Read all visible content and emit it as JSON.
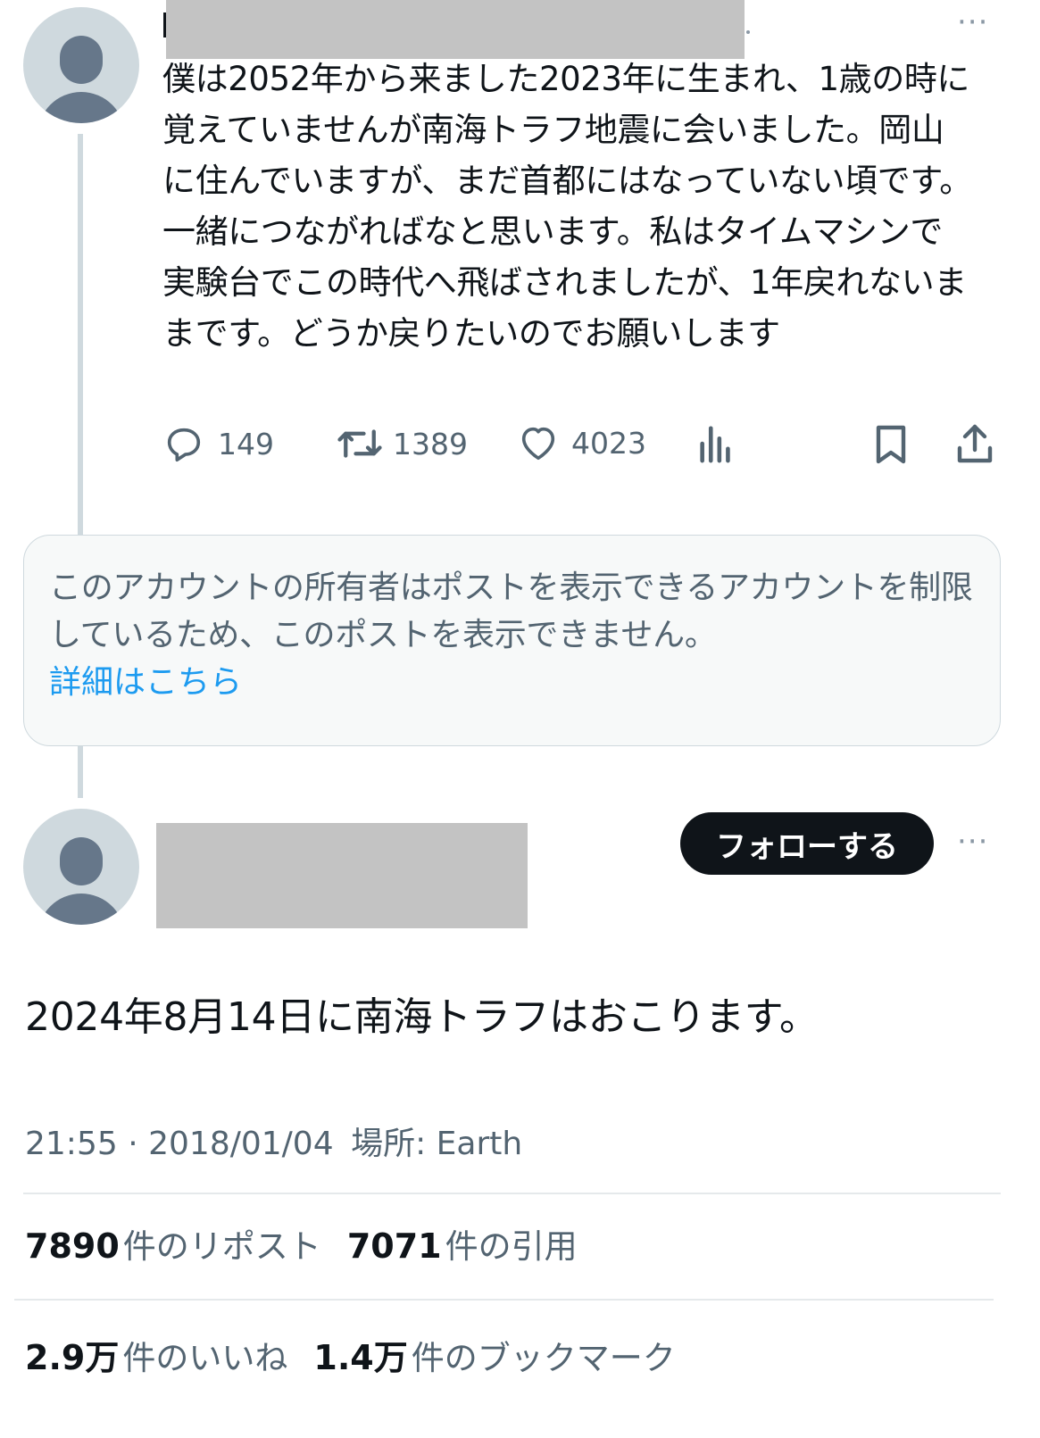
{
  "reply_tweet": {
    "text": "僕は2052年から来ました2023年に生まれ、1歳の時に覚えていませんが南海トラフ地震に会いました。岡山に住んでいますが、まだ首都にはなっていない頃です。一緒につながればなと思います。私はタイムマシンで実験台でこの時代へ飛ばされましたが、1年戻れないままです。どうか戻りたいのでお願いします",
    "more_icon": "···",
    "actions": {
      "replies": "149",
      "reposts": "1389",
      "likes": "4023"
    }
  },
  "restricted_notice": {
    "text": "このアカウントの所有者はポストを表示できるアカウントを制限しているため、このポストを表示できません。",
    "link": "詳細はこちら"
  },
  "main_tweet": {
    "follow_button": "フォローする",
    "more_icon": "···",
    "text": "2024年8月14日に南海トラフはおこります。",
    "time": "21:55",
    "separator": "·",
    "date": "2018/01/04",
    "location": "場所: Earth",
    "stats": {
      "reposts_count": "7890",
      "reposts_label": "件のリポスト",
      "quotes_count": "7071",
      "quotes_label": "件の引用",
      "likes_count": "2.9万",
      "likes_label": "件のいいね",
      "bookmarks_count": "1.4万",
      "bookmarks_label": "件のブックマーク"
    }
  },
  "colors": {
    "text_primary": "#0f1419",
    "text_secondary": "#536471",
    "link": "#1d9bf0",
    "avatar_bg": "#cfd9de",
    "avatar_fg": "#66778a",
    "redaction": "#c3c3c3"
  }
}
